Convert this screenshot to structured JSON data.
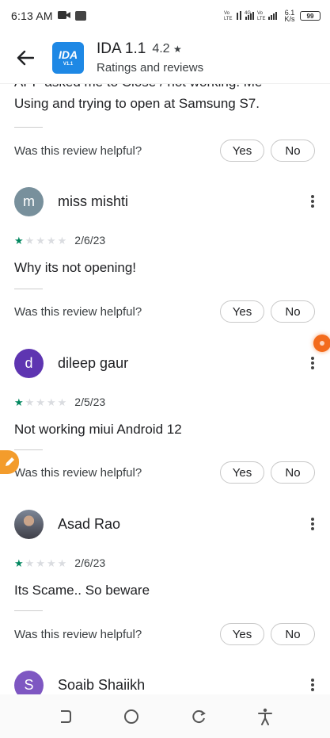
{
  "status_bar": {
    "time": "6:13 AM",
    "net_speed": "6.1 K/s",
    "battery": "99"
  },
  "header": {
    "app_name": "IDA 1.1",
    "rating": "4.2",
    "rating_star": "★",
    "subtitle": "Ratings and reviews",
    "icon_text": "IDA",
    "icon_version": "V1.1"
  },
  "partial_review": {
    "line1": "APP asked me to Close / not working. Me",
    "line2": "Using and trying to open at Samsung S7."
  },
  "helpful": {
    "question": "Was this review helpful?",
    "yes": "Yes",
    "no": "No"
  },
  "reviews": [
    {
      "initial": "m",
      "avatar_color": "#78909c",
      "name": "miss mishti",
      "stars": 1,
      "date": "2/6/23",
      "text": "Why its not opening!"
    },
    {
      "initial": "d",
      "avatar_color": "#5e35b1",
      "name": "dileep gaur",
      "stars": 1,
      "date": "2/5/23",
      "text": "Not working miui Android 12"
    },
    {
      "initial": "",
      "avatar_color": "",
      "name": "Asad Rao",
      "stars": 1,
      "date": "2/6/23",
      "text": "Its Scame.. So beware"
    },
    {
      "initial": "S",
      "avatar_color": "#7e57c2",
      "name": "Soaib Shaiikh",
      "stars": null,
      "date": "",
      "text": ""
    }
  ],
  "colors": {
    "star_on": "#01875f",
    "star_off": "#dadce0",
    "app_icon_bg": "#1E88E5"
  }
}
